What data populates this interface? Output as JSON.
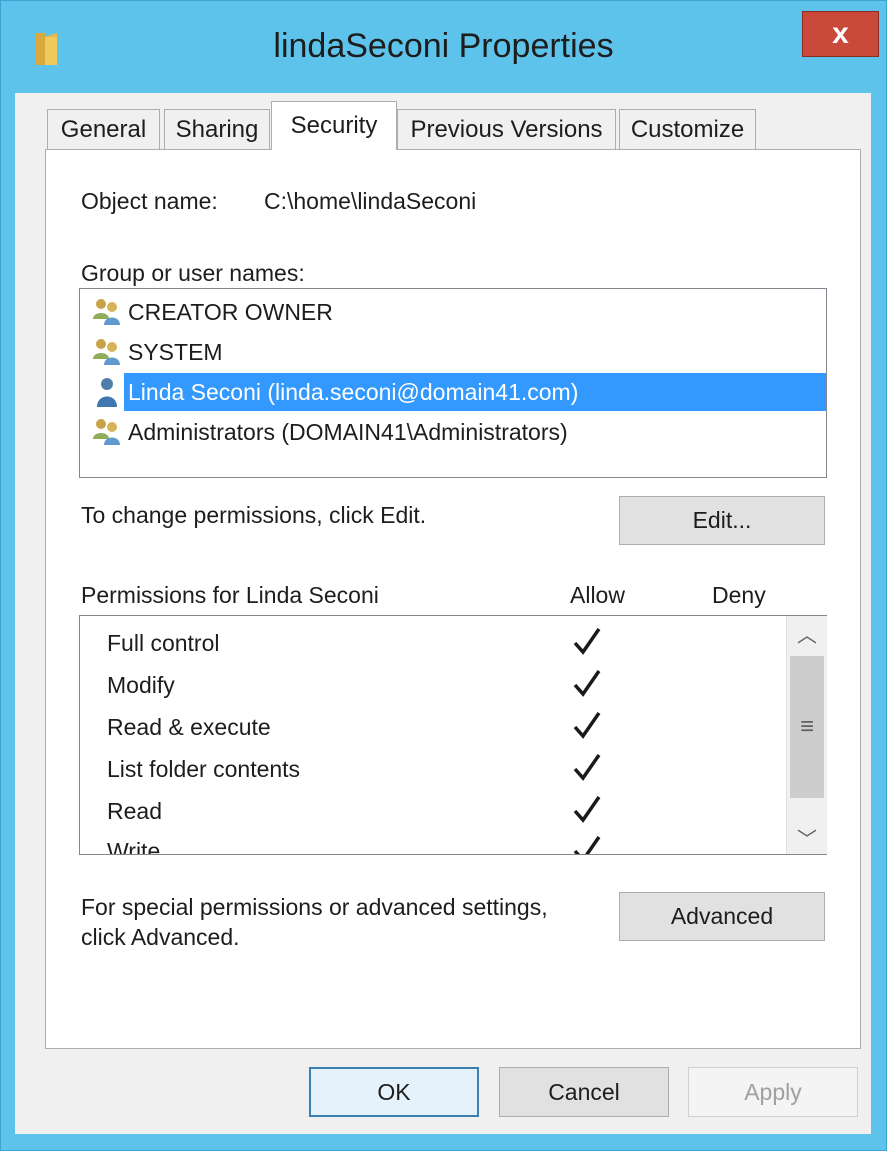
{
  "window": {
    "title": "lindaSeconi Properties",
    "close_label": "x"
  },
  "tabs": [
    {
      "label": "General",
      "active": false
    },
    {
      "label": "Sharing",
      "active": false
    },
    {
      "label": "Security",
      "active": true
    },
    {
      "label": "Previous Versions",
      "active": false
    },
    {
      "label": "Customize",
      "active": false
    }
  ],
  "security": {
    "object_name_label": "Object name:",
    "object_name_value": "C:\\home\\lindaSeconi",
    "group_label": "Group or user names:",
    "users": [
      {
        "name": "CREATOR OWNER",
        "icon": "group-icon",
        "selected": false
      },
      {
        "name": "SYSTEM",
        "icon": "group-icon",
        "selected": false
      },
      {
        "name": "Linda Seconi (linda.seconi@domain41.com)",
        "icon": "user-icon",
        "selected": true
      },
      {
        "name": "Administrators (DOMAIN41\\Administrators)",
        "icon": "group-icon",
        "selected": false
      }
    ],
    "change_hint": "To change permissions, click Edit.",
    "edit_label": "Edit...",
    "permissions_label": "Permissions for Linda Seconi",
    "allow_header": "Allow",
    "deny_header": "Deny",
    "permissions": [
      {
        "name": "Full control",
        "allow": true,
        "deny": false
      },
      {
        "name": "Modify",
        "allow": true,
        "deny": false
      },
      {
        "name": "Read & execute",
        "allow": true,
        "deny": false
      },
      {
        "name": "List folder contents",
        "allow": true,
        "deny": false
      },
      {
        "name": "Read",
        "allow": true,
        "deny": false
      },
      {
        "name": "Write",
        "allow": true,
        "deny": false
      }
    ],
    "advanced_hint_line1": "For special permissions or advanced settings,",
    "advanced_hint_line2": "click Advanced.",
    "advanced_label": "Advanced"
  },
  "footer": {
    "ok_label": "OK",
    "cancel_label": "Cancel",
    "apply_label": "Apply"
  },
  "colors": {
    "title_bar": "#5ec3ea",
    "close_button": "#c9493b",
    "selection": "#3399ff"
  }
}
